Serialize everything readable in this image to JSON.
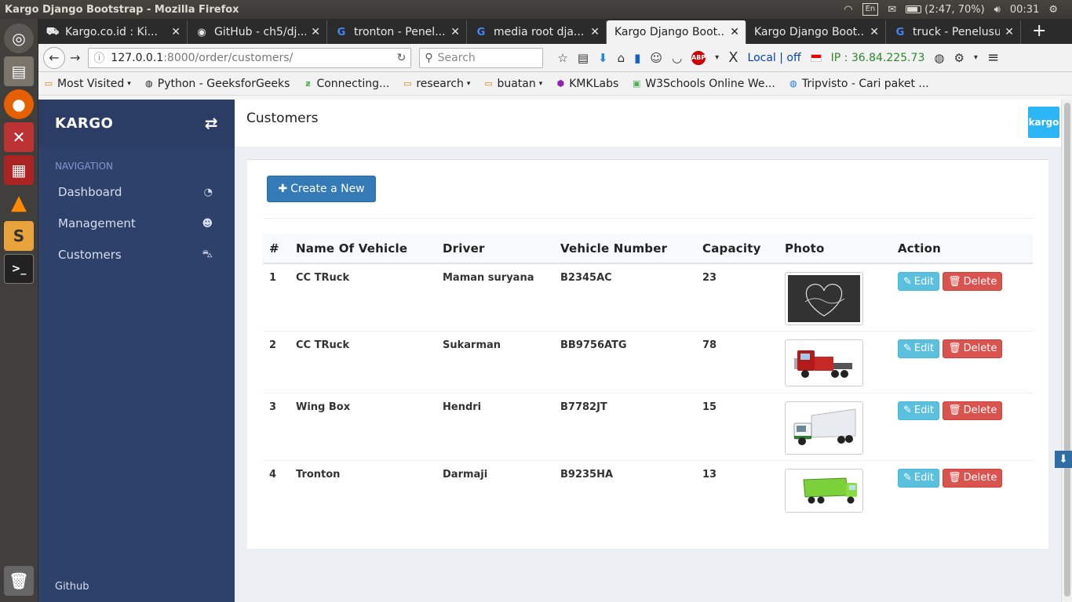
{
  "os": {
    "window_title": "Kargo Django Bootstrap - Mozilla Firefox",
    "keyboard": "En",
    "battery": "(2:47, 70%)",
    "battery_level": 0.7,
    "clock": "00:31"
  },
  "browser": {
    "tabs": [
      {
        "title": "Kargo.co.id : Ki...",
        "icon": "truck-icon"
      },
      {
        "title": "GitHub - ch5/dj...",
        "icon": "github-icon"
      },
      {
        "title": "tronton - Penel...",
        "icon": "google-icon"
      },
      {
        "title": "media root dja...",
        "icon": "google-icon"
      },
      {
        "title": "Kargo Django Boot...",
        "icon": "page-icon",
        "active": true
      },
      {
        "title": "Kargo Django Boot...",
        "icon": "page-icon"
      },
      {
        "title": "truck - Penelusu...",
        "icon": "google-icon"
      }
    ],
    "url_host": "127.0.0.1",
    "url_path": ":8000/order/customers/",
    "search_placeholder": "Search",
    "local_off": "Local | off",
    "ip": "IP : 36.84.225.73",
    "abp": "ABP",
    "bookmarks": [
      {
        "label": "Most Visited",
        "dropdown": true
      },
      {
        "label": "Python - GeeksforGeeks"
      },
      {
        "label": "Connecting..."
      },
      {
        "label": "research",
        "dropdown": true
      },
      {
        "label": "buatan",
        "dropdown": true
      },
      {
        "label": "KMKLabs"
      },
      {
        "label": "W3Schools Online We..."
      },
      {
        "label": "Tripvisto - Cari paket ..."
      }
    ]
  },
  "app": {
    "brand": "KARGO",
    "nav_header": "NAVIGATION",
    "nav": [
      {
        "label": "Dashboard",
        "icon": "dashboard-icon"
      },
      {
        "label": "Management",
        "icon": "users-icon"
      },
      {
        "label": "Customers",
        "icon": "cart-icon"
      }
    ],
    "footer_link": "Github",
    "page_title": "Customers",
    "logo_text": "kargo",
    "create_label": "Create a New",
    "columns": [
      "#",
      "Name Of Vehicle",
      "Driver",
      "Vehicle Number",
      "Capacity",
      "Photo",
      "Action"
    ],
    "rows": [
      {
        "no": "1",
        "name": "CC TRuck",
        "driver": "Maman suryana",
        "number": "B2345AC",
        "capacity": "23",
        "photo": "chalkboard-heart-image"
      },
      {
        "no": "2",
        "name": "CC TRuck",
        "driver": "Sukarman",
        "number": "BB9756ATG",
        "capacity": "78",
        "photo": "red-truck-image"
      },
      {
        "no": "3",
        "name": "Wing Box",
        "driver": "Hendri",
        "number": "B7782JT",
        "capacity": "15",
        "photo": "box-truck-image"
      },
      {
        "no": "4",
        "name": "Tronton",
        "driver": "Darmaji",
        "number": "B9235HA",
        "capacity": "13",
        "photo": "green-dump-truck-image"
      }
    ],
    "edit_label": "Edit",
    "delete_label": "Delete",
    "colors": {
      "sidebar": "#2e416b",
      "primary": "#337ab7",
      "info": "#5bc0de",
      "danger": "#d9534f"
    }
  }
}
